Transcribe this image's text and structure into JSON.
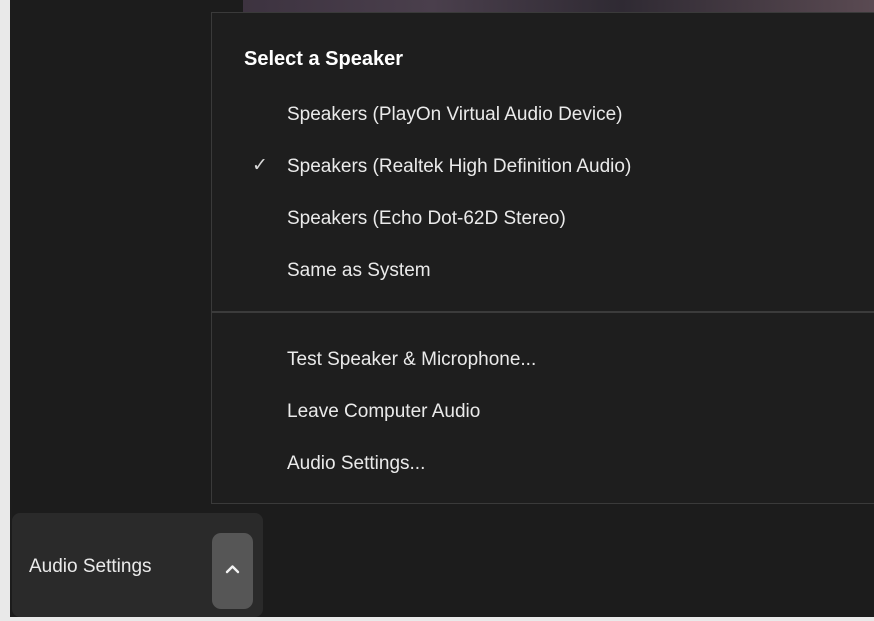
{
  "menu": {
    "header": "Select a Speaker",
    "check_glyph": "✓",
    "speakers": [
      {
        "label": "Speakers (PlayOn Virtual Audio Device)",
        "selected": false
      },
      {
        "label": "Speakers (Realtek High Definition Audio)",
        "selected": true
      },
      {
        "label": "Speakers (Echo Dot-62D Stereo)",
        "selected": false
      },
      {
        "label": "Same as System",
        "selected": false
      }
    ],
    "actions": [
      {
        "label": "Test Speaker & Microphone..."
      },
      {
        "label": "Leave Computer Audio"
      },
      {
        "label": "Audio Settings..."
      }
    ]
  },
  "toolbar": {
    "audio_settings_label": "Audio Settings",
    "caret_icon": "chevron-up-icon"
  },
  "colors": {
    "background": "#1c1c1c",
    "menu_bg": "#1e1e1e",
    "text": "#eaeaea",
    "button_bg": "#2a2a2a",
    "caret_bg": "#565656"
  }
}
